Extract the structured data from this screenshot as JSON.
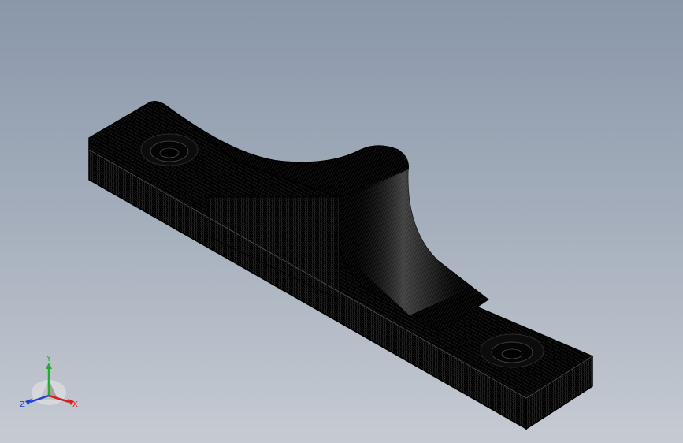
{
  "viewport": {
    "background_top": "#8a97aa",
    "background_bottom": "#c6cbd3",
    "model_color": "#000000",
    "mesh_line_color": "#3a3a3a",
    "icon": "meshed-bracket-part"
  },
  "triad": {
    "icon": "coordinate-axis-triad-icon",
    "x_label": "X",
    "y_label": "Y",
    "z_label": "Z",
    "x_color": "#d42020",
    "y_color": "#1fae2a",
    "z_color": "#1f3fd6"
  }
}
